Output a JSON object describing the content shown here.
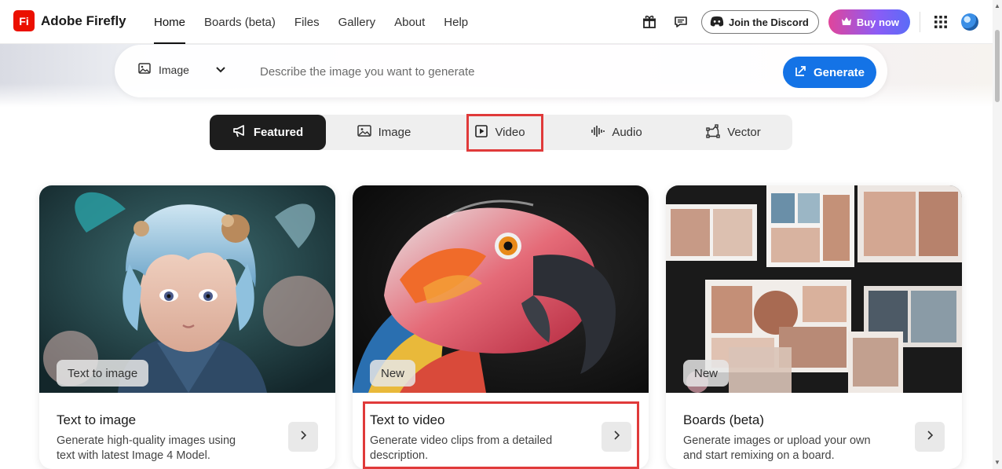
{
  "app": {
    "logo_mark": "Fi",
    "logo_text": "Adobe Firefly",
    "brand_color": "#eb1000"
  },
  "nav": {
    "items": [
      {
        "label": "Home",
        "active": true
      },
      {
        "label": "Boards (beta)"
      },
      {
        "label": "Files"
      },
      {
        "label": "Gallery"
      },
      {
        "label": "About"
      },
      {
        "label": "Help"
      }
    ]
  },
  "header_tools": {
    "gift_icon": "gift-icon",
    "feedback_icon": "chat-icon",
    "discord_label": "Join the Discord",
    "buy_label": "Buy now",
    "apps_icon": "apps-grid-icon"
  },
  "prompt": {
    "type_label": "Image",
    "placeholder": "Describe the image you want to generate",
    "generate_label": "Generate",
    "accent": "#1473e6"
  },
  "tabs": [
    {
      "label": "Featured",
      "icon": "megaphone-icon",
      "selected": true
    },
    {
      "label": "Image",
      "icon": "image-icon"
    },
    {
      "label": "Video",
      "icon": "video-icon",
      "highlighted": true
    },
    {
      "label": "Audio",
      "icon": "waveform-icon"
    },
    {
      "label": "Vector",
      "icon": "vector-icon"
    }
  ],
  "cards": [
    {
      "badge": "Text to image",
      "title": "Text to image",
      "description": "Generate high-quality images using text with latest Image 4 Model."
    },
    {
      "badge": "New",
      "title": "Text to video",
      "description": "Generate video clips from a detailed description.",
      "highlighted": true
    },
    {
      "badge": "New",
      "title": "Boards (beta)",
      "description": "Generate images or upload your own and start remixing on a board."
    }
  ],
  "highlight_color": "#e03a3a"
}
